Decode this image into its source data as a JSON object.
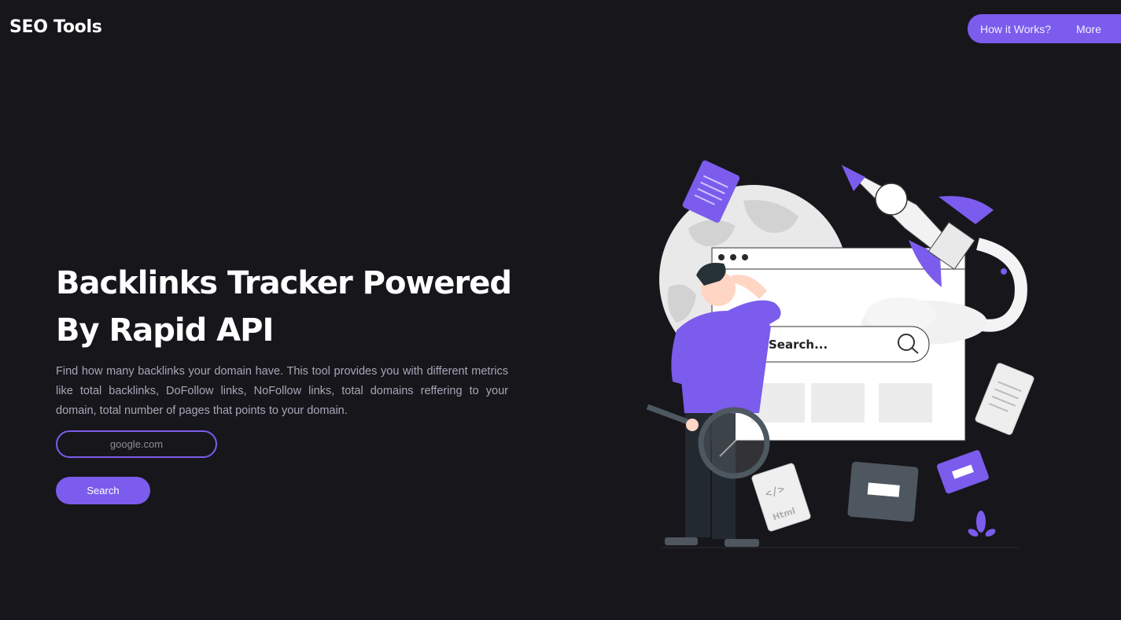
{
  "header": {
    "logo": "SEO Tools",
    "nav": [
      {
        "label": "How it Works?"
      },
      {
        "label": "More"
      }
    ]
  },
  "hero": {
    "title": "Backlinks Tracker Powered By Rapid API",
    "description": "Find how many backlinks your domain have. This tool provides you with different metrics like total backlinks, DoFollow links, NoFollow links, total domains reffering to your domain, total number of pages that points to your domain.",
    "domain_input": {
      "placeholder": "google.com",
      "value": ""
    },
    "search_button": "Search"
  },
  "illustration": {
    "search_text": "Search...",
    "file_label": "Html"
  },
  "colors": {
    "background": "#17161b",
    "accent": "#7b5cec"
  }
}
